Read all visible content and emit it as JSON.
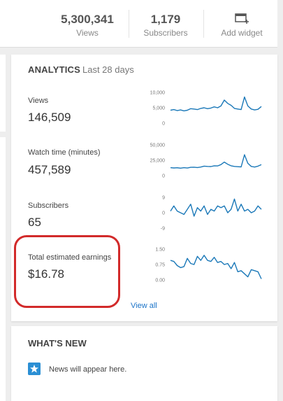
{
  "header_stats": {
    "views": {
      "value": "5,300,341",
      "label": "Views"
    },
    "subscribers": {
      "value": "1,179",
      "label": "Subscribers"
    },
    "add_widget": {
      "label": "Add widget",
      "icon": "add-widget-icon"
    }
  },
  "analytics": {
    "title": "ANALYTICS",
    "period": "Last 28 days",
    "metrics": [
      {
        "label": "Views",
        "value": "146,509",
        "ticks": [
          "10,000",
          "5,000",
          "0"
        ]
      },
      {
        "label": "Watch time (minutes)",
        "value": "457,589",
        "ticks": [
          "50,000",
          "25,000",
          "0"
        ]
      },
      {
        "label": "Subscribers",
        "value": "65",
        "ticks": [
          "9",
          "0",
          "-9"
        ]
      },
      {
        "label": "Total estimated earnings",
        "value": "$16.78",
        "ticks": [
          "1.50",
          "0.75",
          "0.00"
        ]
      }
    ],
    "view_all": "View all"
  },
  "chart_data": [
    {
      "type": "line",
      "ylabel": "Views",
      "ylim": [
        0,
        10000
      ],
      "values": [
        4200,
        4400,
        4100,
        4300,
        4000,
        4200,
        4700,
        4600,
        4400,
        4800,
        5000,
        4700,
        4900,
        5300,
        5000,
        5600,
        7500,
        6400,
        5800,
        4800,
        4600,
        4400,
        8500,
        5600,
        4600,
        4300,
        4500,
        5400
      ]
    },
    {
      "type": "line",
      "ylabel": "Watch time (minutes)",
      "ylim": [
        0,
        50000
      ],
      "values": [
        13000,
        12500,
        12800,
        12200,
        13000,
        12400,
        13500,
        13800,
        13200,
        14000,
        15500,
        15000,
        14800,
        16000,
        15800,
        18000,
        22000,
        18500,
        16000,
        15000,
        14500,
        14200,
        34000,
        20000,
        15000,
        14000,
        15500,
        18000
      ]
    },
    {
      "type": "line",
      "ylabel": "Subscribers",
      "ylim": [
        -9,
        9
      ],
      "values": [
        1,
        4,
        1,
        0,
        -1,
        2,
        5,
        -2,
        3,
        1,
        4,
        -1,
        2,
        1,
        4,
        3,
        4,
        0,
        2,
        8,
        1,
        5,
        1,
        2,
        0,
        1,
        4,
        2
      ]
    },
    {
      "type": "line",
      "ylabel": "Total estimated earnings",
      "ylim": [
        0,
        1.5
      ],
      "values": [
        0.95,
        0.9,
        0.7,
        0.6,
        0.65,
        1.05,
        0.8,
        0.75,
        1.15,
        0.95,
        1.2,
        0.95,
        0.9,
        1.1,
        0.85,
        0.9,
        0.75,
        0.8,
        0.55,
        0.85,
        0.4,
        0.45,
        0.3,
        0.15,
        0.5,
        0.45,
        0.4,
        0.05
      ]
    }
  ],
  "whats_new": {
    "title": "WHAT'S NEW",
    "message": "News will appear here.",
    "icon": "star-icon"
  },
  "colors": {
    "line": "#1a78b8",
    "highlight": "#d22a2a",
    "link": "#1a73c8"
  }
}
